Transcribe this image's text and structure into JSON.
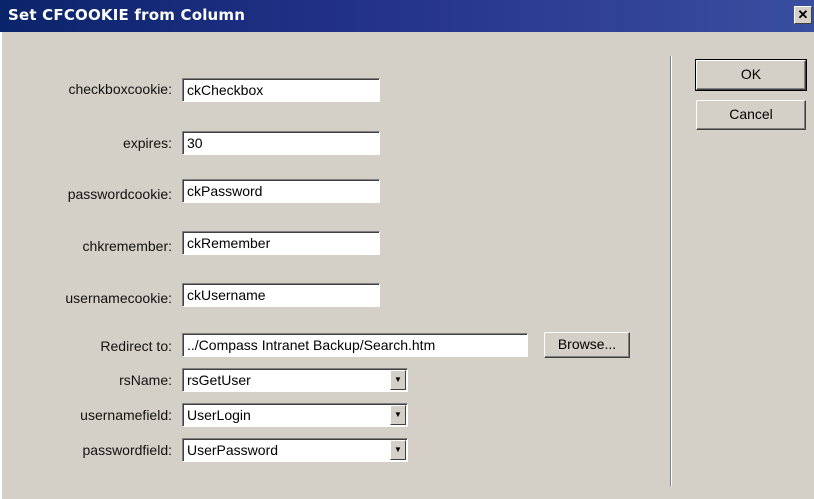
{
  "window": {
    "title": "Set CFCOOKIE from Column",
    "close_glyph": "✕"
  },
  "fields": {
    "checkboxcookie": {
      "label": "checkboxcookie:",
      "value": "ckCheckbox"
    },
    "expires": {
      "label": "expires:",
      "value": "30"
    },
    "passwordcookie": {
      "label": "passwordcookie:",
      "value": "ckPassword"
    },
    "chkremember": {
      "label": "chkremember:",
      "value": "ckRemember"
    },
    "usernamecookie": {
      "label": "usernamecookie:",
      "value": "ckUsername"
    },
    "redirect": {
      "label": "Redirect to:",
      "value": "../Compass Intranet Backup/Search.htm"
    },
    "rsName": {
      "label": "rsName:",
      "value": "rsGetUser"
    },
    "usernamefield": {
      "label": "usernamefield:",
      "value": "UserLogin"
    },
    "passwordfield": {
      "label": "passwordfield:",
      "value": "UserPassword"
    }
  },
  "buttons": {
    "ok": "OK",
    "cancel": "Cancel",
    "browse": "Browse..."
  },
  "icons": {
    "dropdown_arrow": "▼"
  }
}
